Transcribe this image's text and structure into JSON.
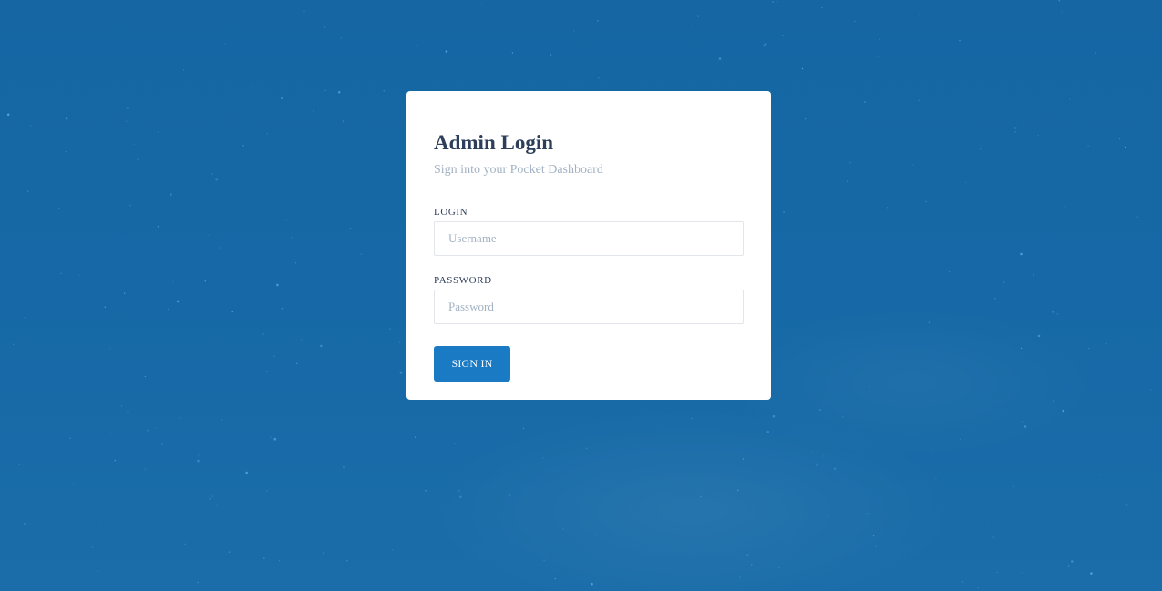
{
  "colors": {
    "background": "#1669a6",
    "card": "#ffffff",
    "title_text": "#2c3e5a",
    "muted_text": "#a3b2c3",
    "primary_button": "#1a7ac4",
    "input_border": "#e2e6ea"
  },
  "login_card": {
    "title": "Admin Login",
    "subtitle": "Sign into your Pocket Dashboard",
    "fields": {
      "login": {
        "label": "LOGIN",
        "placeholder": "Username",
        "value": ""
      },
      "password": {
        "label": "PASSWORD",
        "placeholder": "Password",
        "value": ""
      }
    },
    "submit_label": "SIGN IN"
  }
}
